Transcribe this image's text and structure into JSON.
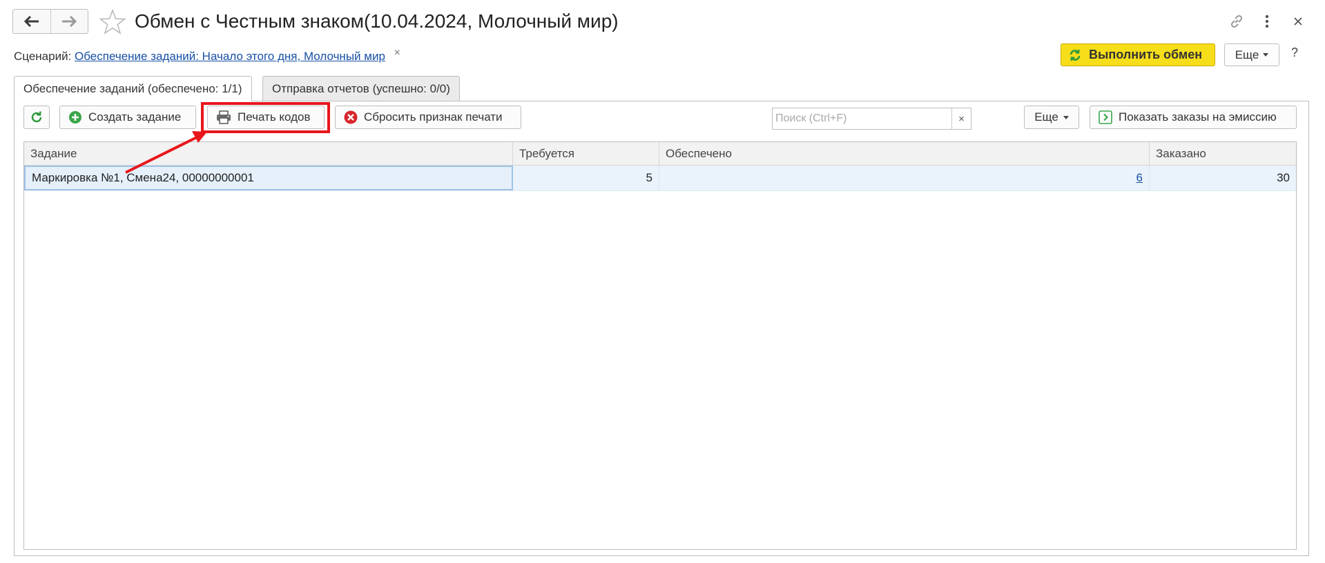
{
  "window": {
    "title": "Обмен с Честным знаком(10.04.2024, Молочный мир)"
  },
  "scenario": {
    "label": "Сценарий:",
    "link": "Обеспечение заданий: Начало этого дня, Молочный мир",
    "clear": "×"
  },
  "header_actions": {
    "exchange_label": "Выполнить обмен",
    "more_label": "Еще",
    "help_label": "?"
  },
  "tabs": [
    {
      "label": "Обеспечение заданий (обеспечено: 1/1)",
      "active": true
    },
    {
      "label": "Отправка отчетов (успешно: 0/0)",
      "active": false
    }
  ],
  "toolbar": {
    "create_label": "Создать задание",
    "print_label": "Печать кодов",
    "reset_label": "Сбросить признак печати",
    "search_placeholder": "Поиск (Ctrl+F)",
    "search_clear": "×",
    "more_label": "Еще",
    "show_orders_label": "Показать заказы на эмиссию"
  },
  "table": {
    "columns": [
      "Задание",
      "Требуется",
      "Обеспечено",
      "Заказано"
    ],
    "rows": [
      {
        "task": "Маркировка №1, Смена24, 00000000001",
        "required": "5",
        "provided": "6",
        "ordered": "30"
      }
    ]
  },
  "colors": {
    "accent_yellow": "#f7de1a",
    "highlight_red": "#e8161c",
    "link_blue": "#1750a5",
    "refresh_green": "#2f9a3a",
    "reset_red": "#d8262b"
  },
  "icons": [
    "back-arrow-icon",
    "forward-arrow-icon",
    "star-icon",
    "link-icon",
    "kebab-menu-icon",
    "close-icon",
    "refresh-icon",
    "plus-circle-icon",
    "printer-icon",
    "error-circle-icon",
    "chevron-right-icon",
    "dropdown-caret-icon"
  ]
}
